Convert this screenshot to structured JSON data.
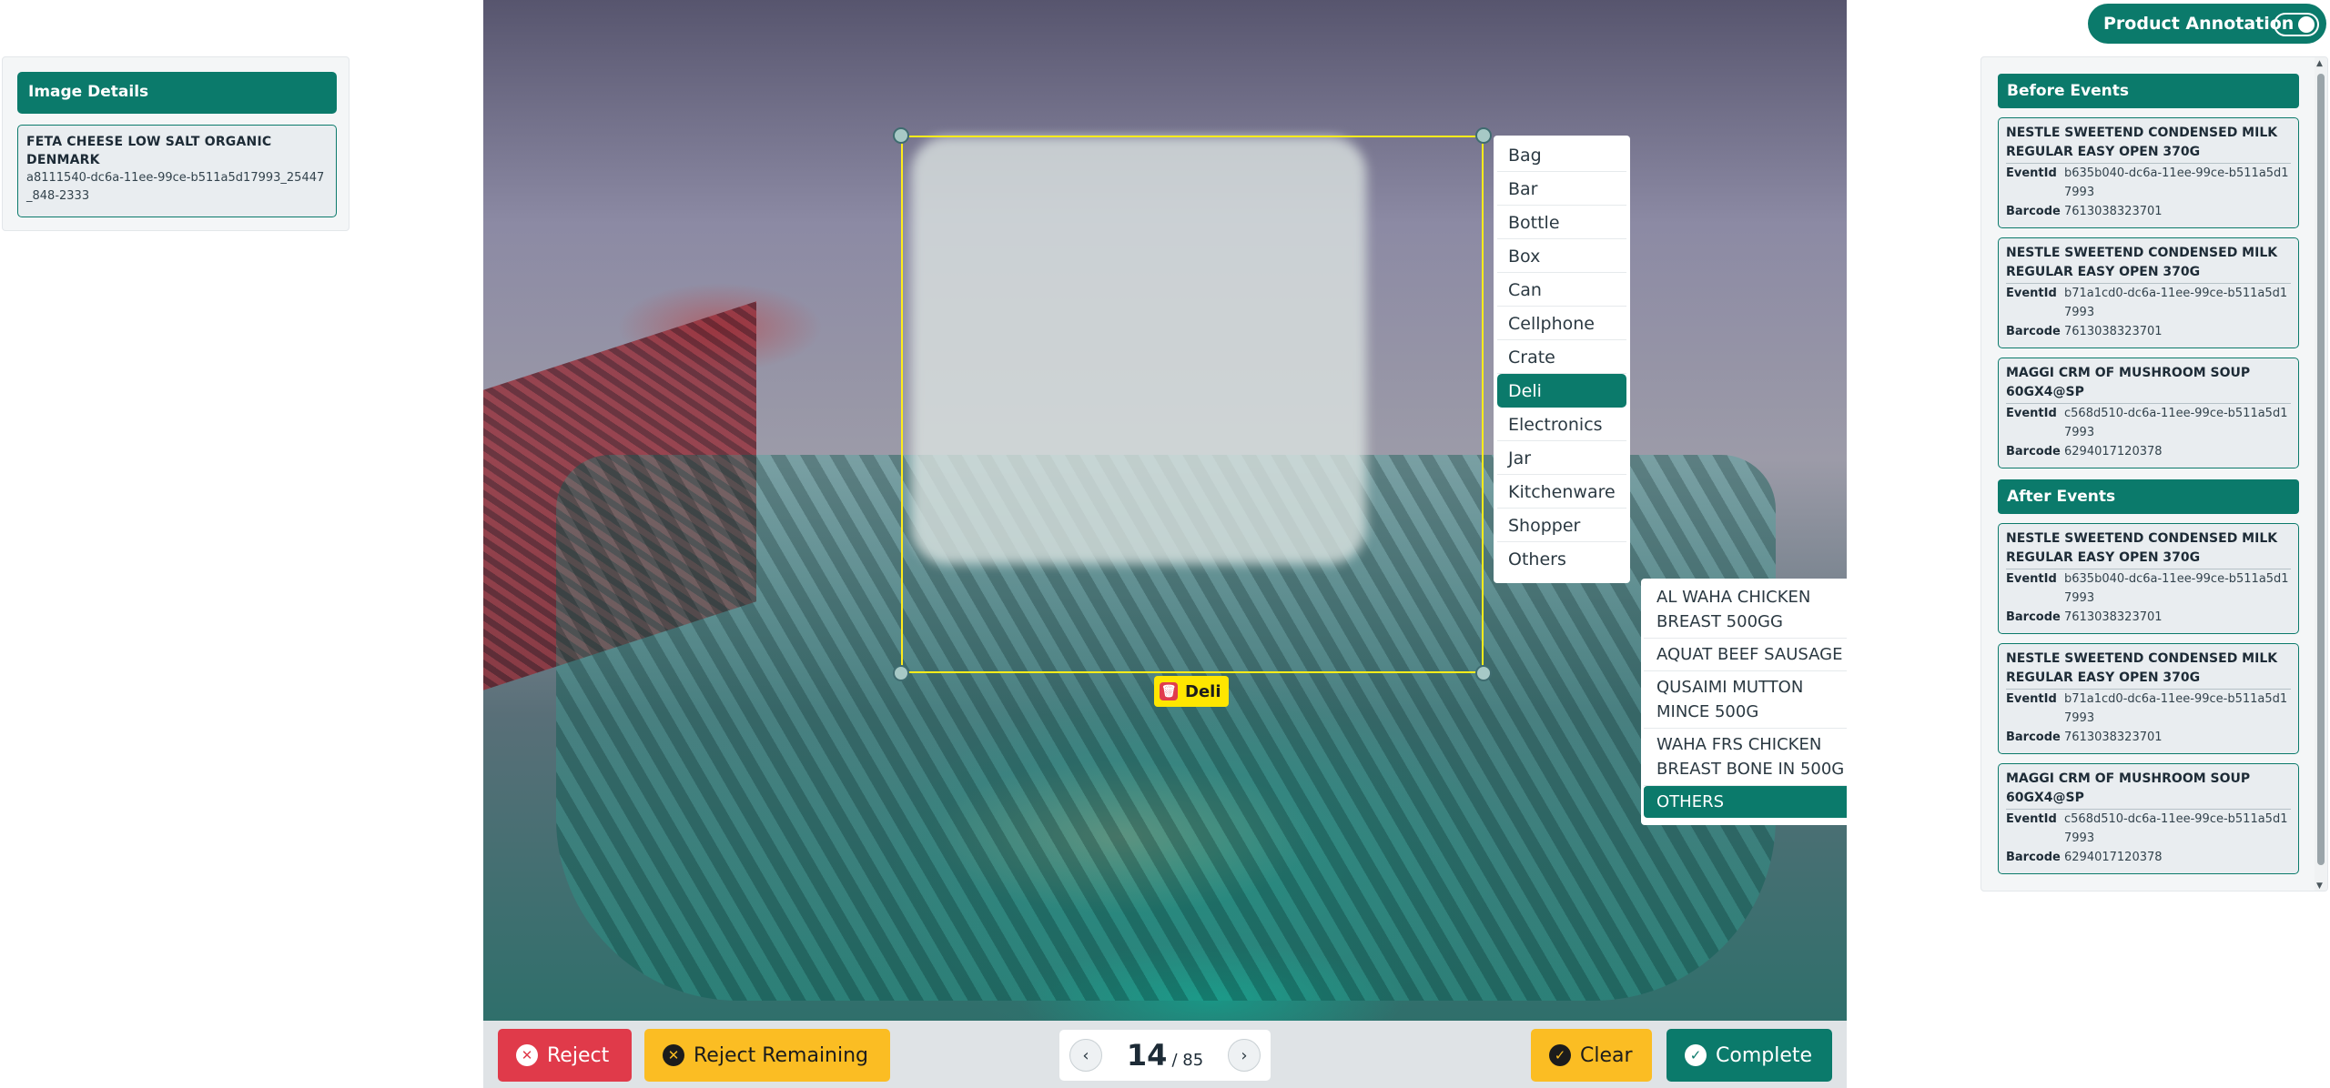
{
  "image_details": {
    "title": "Image Details",
    "product_name": "FETA CHEESE LOW SALT ORGANIC DENMARK",
    "product_id": "a8111540-dc6a-11ee-99ce-b511a5d17993_25447_848-2333"
  },
  "annotation": {
    "tag_label": "Deli",
    "categories": [
      "Bag",
      "Bar",
      "Bottle",
      "Box",
      "Can",
      "Cellphone",
      "Crate",
      "Deli",
      "Electronics",
      "Jar",
      "Kitchenware",
      "Shopper",
      "Others"
    ],
    "selected_category": "Deli",
    "products": [
      "AL WAHA CHICKEN BREAST 500GG",
      "AQUAT BEEF SAUSAGE",
      "QUSAIMI MUTTON MINCE 500G",
      "WAHA FRS CHICKEN BREAST BONE IN 500G",
      "OTHERS"
    ],
    "selected_product": "OTHERS"
  },
  "bottom_bar": {
    "reject_label": "Reject",
    "reject_remaining_label": "Reject Remaining",
    "page_current": "14",
    "page_total": "/ 85",
    "clear_label": "Clear",
    "complete_label": "Complete"
  },
  "toggle": {
    "label": "Product Annotation",
    "on": true
  },
  "events": {
    "before_title": "Before Events",
    "after_title": "After Events",
    "event_id_key": "EventId",
    "barcode_key": "Barcode",
    "before": [
      {
        "name": "NESTLE SWEETEND CONDENSED MILK REGULAR EASY OPEN 370G",
        "event_id": "b635b040-dc6a-11ee-99ce-b511a5d17993",
        "barcode": "7613038323701"
      },
      {
        "name": "NESTLE SWEETEND CONDENSED MILK REGULAR EASY OPEN 370G",
        "event_id": "b71a1cd0-dc6a-11ee-99ce-b511a5d17993",
        "barcode": "7613038323701"
      },
      {
        "name": "MAGGI CRM OF MUSHROOM SOUP 60GX4@SP",
        "event_id": "c568d510-dc6a-11ee-99ce-b511a5d17993",
        "barcode": "6294017120378"
      }
    ],
    "after": [
      {
        "name": "NESTLE SWEETEND CONDENSED MILK REGULAR EASY OPEN 370G",
        "event_id": "b635b040-dc6a-11ee-99ce-b511a5d17993",
        "barcode": "7613038323701"
      },
      {
        "name": "NESTLE SWEETEND CONDENSED MILK REGULAR EASY OPEN 370G",
        "event_id": "b71a1cd0-dc6a-11ee-99ce-b511a5d17993",
        "barcode": "7613038323701"
      },
      {
        "name": "MAGGI CRM OF MUSHROOM SOUP 60GX4@SP",
        "event_id": "c568d510-dc6a-11ee-99ce-b511a5d17993",
        "barcode": "6294017120378"
      }
    ]
  },
  "colors": {
    "primary": "#0b7a6b",
    "danger": "#e03a4a",
    "warning": "#fbbd23",
    "bbox": "#ffec1a"
  }
}
